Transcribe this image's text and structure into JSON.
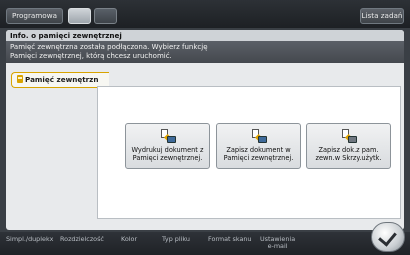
{
  "topbar": {
    "program_label": "Programowa",
    "jobs_label": "Lista zadań",
    "mode_icons": [
      "copy-icon",
      "scan-icon"
    ]
  },
  "panel": {
    "title": "Info. o pamięci zewnętrznej",
    "message_line1": "Pamięć zewnętrzna została podłączona. Wybierz funkcję",
    "message_line2": "Pamięci zewnętrznej, którą chcesz uruchomić."
  },
  "tab": {
    "label": "Pamięć zewnętrzn",
    "icon": "usb-icon"
  },
  "tiles": [
    {
      "label_line1": "Wydrukuj dokument z",
      "label_line2": "Pamięci zewnętrznej.",
      "icon": "print-doc-icon"
    },
    {
      "label_line1": "Zapisz dokument w",
      "label_line2": "Pamięci zewnętrznej.",
      "icon": "save-doc-icon"
    },
    {
      "label_line1": "Zapisz dok.z pam.",
      "label_line2": "zewn.w Skrzy.użytk.",
      "icon": "box-doc-icon"
    }
  ],
  "bottombar": {
    "items": [
      {
        "line1": "Simpl./duplekx",
        "line2": ""
      },
      {
        "line1": "Rozdzielczość",
        "line2": ""
      },
      {
        "line1": "Kolor",
        "line2": ""
      },
      {
        "line1": "Typ pliku",
        "line2": ""
      },
      {
        "line1": "Format skanu",
        "line2": ""
      },
      {
        "line1": "Ustawienia",
        "line2": "e-mail"
      }
    ]
  },
  "colors": {
    "accent_tab_border": "#d8a400",
    "panel_bg": "#e8eaec",
    "header_bar": "#4f545a"
  }
}
